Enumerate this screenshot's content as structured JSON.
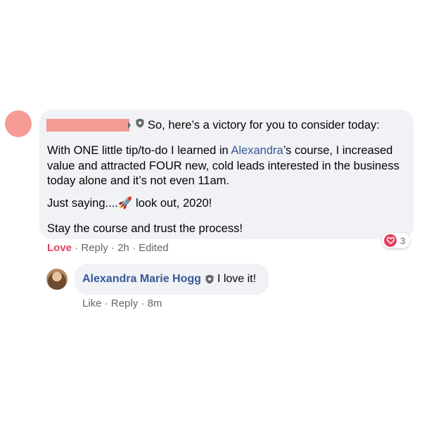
{
  "comment": {
    "author_redacted": true,
    "lines": [
      "So, here’s a victory for you to consider today:",
      "With ONE little tip/to-do I learned in ",
      "Alexandra",
      "’s course, I increased",
      "value and attracted FOUR new, cold leads interested in the business",
      "today alone and it’s not even 11am.",
      "Just saying....",
      " look out, 2020!",
      "Stay the course and trust the process!"
    ],
    "emoji": "🚀",
    "actions": {
      "love": "Love",
      "reply": "Reply",
      "time": "2h",
      "edited": "Edited",
      "sep": " · "
    },
    "reaction_count": "3"
  },
  "reply": {
    "author": "Alexandra Marie Hogg",
    "text": "I love it!",
    "actions": {
      "like": "Like",
      "reply": "Reply",
      "time": "8m",
      "sep": " · "
    }
  },
  "colors": {
    "link": "#385898",
    "love": "#e4405f",
    "bubble": "#f0f2f5",
    "redaction": "#f59a94"
  }
}
